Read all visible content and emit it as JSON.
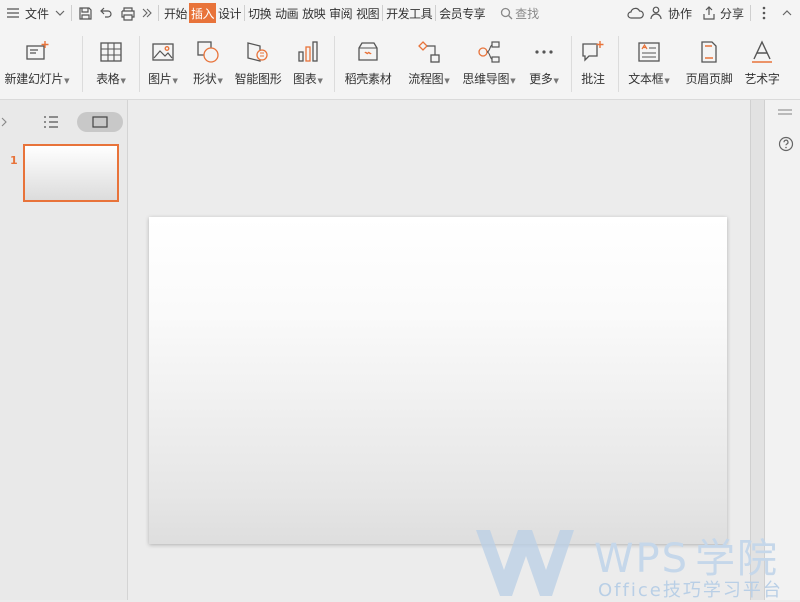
{
  "menu": {
    "file_label": "文件",
    "tabs": [
      "开始",
      "插入",
      "设计",
      "切换",
      "动画",
      "放映",
      "审阅",
      "视图",
      "开发工具",
      "会员专享"
    ],
    "active_tab": 1,
    "search_label": "查找",
    "collab_label": "协作",
    "share_label": "分享"
  },
  "ribbon": {
    "new_slide": "新建幻灯片",
    "table": "表格",
    "picture": "图片",
    "shape": "形状",
    "smartart": "智能图形",
    "chart": "图表",
    "material": "稻壳素材",
    "flowchart": "流程图",
    "mindmap": "思维导图",
    "more": "更多",
    "comment": "批注",
    "textbox": "文本框",
    "header_footer": "页眉页脚",
    "wordart": "艺术字"
  },
  "slides": {
    "current_number": "1"
  },
  "watermark": {
    "brand": "WPS",
    "brand_suffix": "学院",
    "tagline": "Office技巧学习平台"
  },
  "colors": {
    "accent": "#e8733a",
    "watermark": "#b9cfe6"
  }
}
